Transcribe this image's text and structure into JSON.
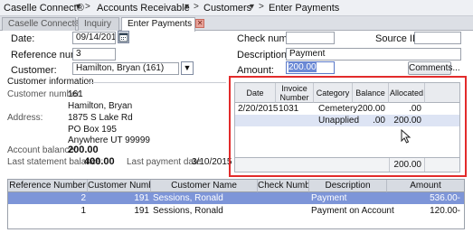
{
  "breadcrumb": {
    "items": [
      "Caselle Connect®",
      "Accounts Receivable",
      "Customers",
      "Enter Payments"
    ]
  },
  "tabs": [
    {
      "label": "Caselle Connect®"
    },
    {
      "label": "Inquiry"
    },
    {
      "label": "Enter Payments"
    }
  ],
  "form": {
    "date_label": "Date:",
    "date_value": "09/14/2016",
    "refnum_label": "Reference number:",
    "refnum_value": "3",
    "customer_label": "Customer:",
    "customer_value": "Hamilton, Bryan (161)",
    "check_label": "Check number:",
    "check_value": "",
    "source_label": "Source ID:",
    "source_value": "",
    "desc_label": "Description:",
    "desc_value": "Payment",
    "amount_label": "Amount:",
    "amount_value": "200.00",
    "comments_label": "Comments..."
  },
  "customer_info": {
    "heading": "Customer information",
    "number_label": "Customer number:",
    "number_value": "161",
    "name_value": "Hamilton, Bryan",
    "address_label": "Address:",
    "address_line1": "1875 S Lake Rd",
    "address_line2": "PO Box 195",
    "address_line3": "Anywhere  UT  99999",
    "balance_label": "Account balance:",
    "balance_value": "200.00",
    "last_stmt_label": "Last statement balance:",
    "last_stmt_value": "400.00",
    "last_pay_label": "Last payment date:",
    "last_pay_value": "3/10/2015"
  },
  "allocation": {
    "headers": [
      "Date",
      "Invoice Number",
      "Category",
      "Balance",
      "Allocated"
    ],
    "rows": [
      {
        "date": "2/20/2015",
        "invoice": "1031",
        "category": "Cemetery",
        "balance": "200.00",
        "allocated": ".00"
      },
      {
        "date": "",
        "invoice": "",
        "category": "Unapplied",
        "balance": ".00",
        "allocated": "200.00"
      }
    ],
    "total": "200.00"
  },
  "payments": {
    "headers": [
      "Reference Number",
      "Customer Number",
      "Customer Name",
      "Check Number",
      "Description",
      "Amount"
    ],
    "rows": [
      {
        "ref": "2",
        "cust_num": "191",
        "cust_name": "Sessions, Ronald",
        "check": "",
        "desc": "Payment",
        "amount": "536.00-"
      },
      {
        "ref": "1",
        "cust_num": "191",
        "cust_name": "Sessions, Ronald",
        "check": "",
        "desc": "Payment on Account",
        "amount": "120.00-"
      }
    ]
  },
  "colors": {
    "highlight_frame": "#e22b2b",
    "selection": "#7d95d8"
  }
}
